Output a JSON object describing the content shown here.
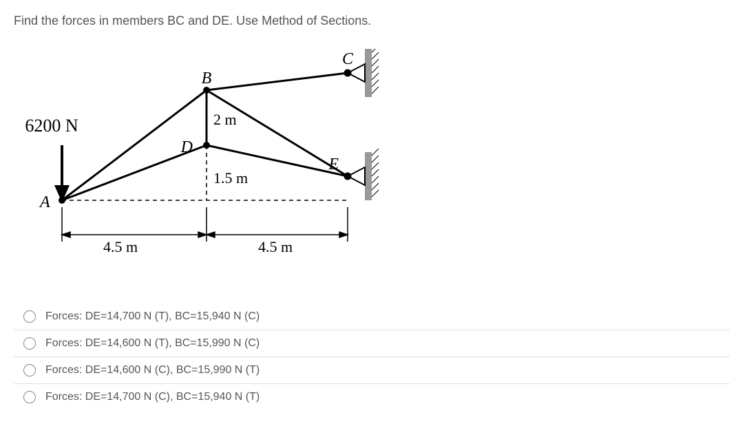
{
  "question": "Find the forces in members BC and DE. Use Method of Sections.",
  "diagram": {
    "force_label": "6200 N",
    "node_A": "A",
    "node_B": "B",
    "node_C": "C",
    "node_D": "D",
    "node_E": "E",
    "dim_BD": "2 m",
    "dim_DA_vert": "1.5 m",
    "dim_left": "4.5 m",
    "dim_right": "4.5 m"
  },
  "options": [
    {
      "text": "Forces: DE=14,700 N (T), BC=15,940 N (C)"
    },
    {
      "text": "Forces: DE=14,600 N (T), BC=15,990 N (C)"
    },
    {
      "text": "Forces: DE=14,600 N (C), BC=15,990 N (T)"
    },
    {
      "text": "Forces: DE=14,700 N (C), BC=15,940 N (T)"
    }
  ]
}
